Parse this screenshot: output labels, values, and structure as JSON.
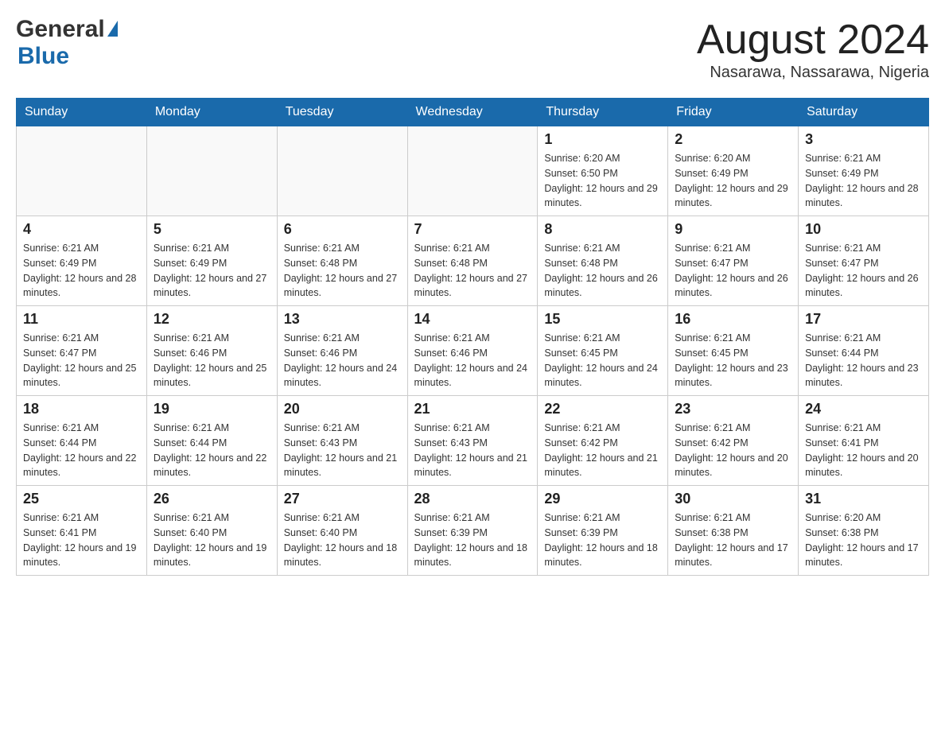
{
  "header": {
    "logo_general": "General",
    "logo_blue": "Blue",
    "month_title": "August 2024",
    "location": "Nasarawa, Nassarawa, Nigeria"
  },
  "days_of_week": [
    "Sunday",
    "Monday",
    "Tuesday",
    "Wednesday",
    "Thursday",
    "Friday",
    "Saturday"
  ],
  "weeks": [
    [
      {
        "day": "",
        "sunrise": "",
        "sunset": "",
        "daylight": ""
      },
      {
        "day": "",
        "sunrise": "",
        "sunset": "",
        "daylight": ""
      },
      {
        "day": "",
        "sunrise": "",
        "sunset": "",
        "daylight": ""
      },
      {
        "day": "",
        "sunrise": "",
        "sunset": "",
        "daylight": ""
      },
      {
        "day": "1",
        "sunrise": "Sunrise: 6:20 AM",
        "sunset": "Sunset: 6:50 PM",
        "daylight": "Daylight: 12 hours and 29 minutes."
      },
      {
        "day": "2",
        "sunrise": "Sunrise: 6:20 AM",
        "sunset": "Sunset: 6:49 PM",
        "daylight": "Daylight: 12 hours and 29 minutes."
      },
      {
        "day": "3",
        "sunrise": "Sunrise: 6:21 AM",
        "sunset": "Sunset: 6:49 PM",
        "daylight": "Daylight: 12 hours and 28 minutes."
      }
    ],
    [
      {
        "day": "4",
        "sunrise": "Sunrise: 6:21 AM",
        "sunset": "Sunset: 6:49 PM",
        "daylight": "Daylight: 12 hours and 28 minutes."
      },
      {
        "day": "5",
        "sunrise": "Sunrise: 6:21 AM",
        "sunset": "Sunset: 6:49 PM",
        "daylight": "Daylight: 12 hours and 27 minutes."
      },
      {
        "day": "6",
        "sunrise": "Sunrise: 6:21 AM",
        "sunset": "Sunset: 6:48 PM",
        "daylight": "Daylight: 12 hours and 27 minutes."
      },
      {
        "day": "7",
        "sunrise": "Sunrise: 6:21 AM",
        "sunset": "Sunset: 6:48 PM",
        "daylight": "Daylight: 12 hours and 27 minutes."
      },
      {
        "day": "8",
        "sunrise": "Sunrise: 6:21 AM",
        "sunset": "Sunset: 6:48 PM",
        "daylight": "Daylight: 12 hours and 26 minutes."
      },
      {
        "day": "9",
        "sunrise": "Sunrise: 6:21 AM",
        "sunset": "Sunset: 6:47 PM",
        "daylight": "Daylight: 12 hours and 26 minutes."
      },
      {
        "day": "10",
        "sunrise": "Sunrise: 6:21 AM",
        "sunset": "Sunset: 6:47 PM",
        "daylight": "Daylight: 12 hours and 26 minutes."
      }
    ],
    [
      {
        "day": "11",
        "sunrise": "Sunrise: 6:21 AM",
        "sunset": "Sunset: 6:47 PM",
        "daylight": "Daylight: 12 hours and 25 minutes."
      },
      {
        "day": "12",
        "sunrise": "Sunrise: 6:21 AM",
        "sunset": "Sunset: 6:46 PM",
        "daylight": "Daylight: 12 hours and 25 minutes."
      },
      {
        "day": "13",
        "sunrise": "Sunrise: 6:21 AM",
        "sunset": "Sunset: 6:46 PM",
        "daylight": "Daylight: 12 hours and 24 minutes."
      },
      {
        "day": "14",
        "sunrise": "Sunrise: 6:21 AM",
        "sunset": "Sunset: 6:46 PM",
        "daylight": "Daylight: 12 hours and 24 minutes."
      },
      {
        "day": "15",
        "sunrise": "Sunrise: 6:21 AM",
        "sunset": "Sunset: 6:45 PM",
        "daylight": "Daylight: 12 hours and 24 minutes."
      },
      {
        "day": "16",
        "sunrise": "Sunrise: 6:21 AM",
        "sunset": "Sunset: 6:45 PM",
        "daylight": "Daylight: 12 hours and 23 minutes."
      },
      {
        "day": "17",
        "sunrise": "Sunrise: 6:21 AM",
        "sunset": "Sunset: 6:44 PM",
        "daylight": "Daylight: 12 hours and 23 minutes."
      }
    ],
    [
      {
        "day": "18",
        "sunrise": "Sunrise: 6:21 AM",
        "sunset": "Sunset: 6:44 PM",
        "daylight": "Daylight: 12 hours and 22 minutes."
      },
      {
        "day": "19",
        "sunrise": "Sunrise: 6:21 AM",
        "sunset": "Sunset: 6:44 PM",
        "daylight": "Daylight: 12 hours and 22 minutes."
      },
      {
        "day": "20",
        "sunrise": "Sunrise: 6:21 AM",
        "sunset": "Sunset: 6:43 PM",
        "daylight": "Daylight: 12 hours and 21 minutes."
      },
      {
        "day": "21",
        "sunrise": "Sunrise: 6:21 AM",
        "sunset": "Sunset: 6:43 PM",
        "daylight": "Daylight: 12 hours and 21 minutes."
      },
      {
        "day": "22",
        "sunrise": "Sunrise: 6:21 AM",
        "sunset": "Sunset: 6:42 PM",
        "daylight": "Daylight: 12 hours and 21 minutes."
      },
      {
        "day": "23",
        "sunrise": "Sunrise: 6:21 AM",
        "sunset": "Sunset: 6:42 PM",
        "daylight": "Daylight: 12 hours and 20 minutes."
      },
      {
        "day": "24",
        "sunrise": "Sunrise: 6:21 AM",
        "sunset": "Sunset: 6:41 PM",
        "daylight": "Daylight: 12 hours and 20 minutes."
      }
    ],
    [
      {
        "day": "25",
        "sunrise": "Sunrise: 6:21 AM",
        "sunset": "Sunset: 6:41 PM",
        "daylight": "Daylight: 12 hours and 19 minutes."
      },
      {
        "day": "26",
        "sunrise": "Sunrise: 6:21 AM",
        "sunset": "Sunset: 6:40 PM",
        "daylight": "Daylight: 12 hours and 19 minutes."
      },
      {
        "day": "27",
        "sunrise": "Sunrise: 6:21 AM",
        "sunset": "Sunset: 6:40 PM",
        "daylight": "Daylight: 12 hours and 18 minutes."
      },
      {
        "day": "28",
        "sunrise": "Sunrise: 6:21 AM",
        "sunset": "Sunset: 6:39 PM",
        "daylight": "Daylight: 12 hours and 18 minutes."
      },
      {
        "day": "29",
        "sunrise": "Sunrise: 6:21 AM",
        "sunset": "Sunset: 6:39 PM",
        "daylight": "Daylight: 12 hours and 18 minutes."
      },
      {
        "day": "30",
        "sunrise": "Sunrise: 6:21 AM",
        "sunset": "Sunset: 6:38 PM",
        "daylight": "Daylight: 12 hours and 17 minutes."
      },
      {
        "day": "31",
        "sunrise": "Sunrise: 6:20 AM",
        "sunset": "Sunset: 6:38 PM",
        "daylight": "Daylight: 12 hours and 17 minutes."
      }
    ]
  ]
}
